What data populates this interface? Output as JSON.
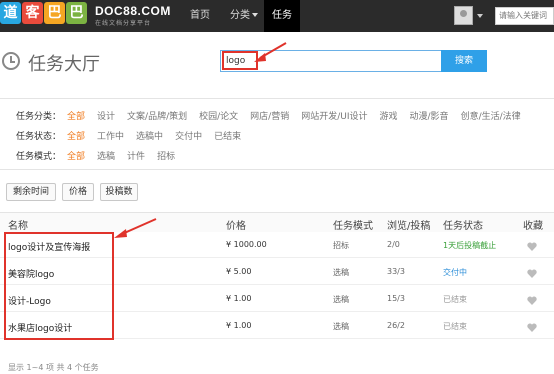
{
  "header": {
    "logo_chars": [
      "道",
      "客",
      "巴",
      "巴"
    ],
    "logo_text": "DOC88.COM",
    "logo_sub": "在线文档分享平台",
    "nav": {
      "home": "首页",
      "category": "分类",
      "task": "任务"
    },
    "search_placeholder": "请输入关键词"
  },
  "title": "任务大厅",
  "search": {
    "value": "logo",
    "button": "搜索"
  },
  "filters": {
    "category": {
      "label": "任务分类：",
      "options": [
        "全部",
        "设计",
        "文案/品牌/策划",
        "校园/论文",
        "网店/营销",
        "网站开发/UI设计",
        "游戏",
        "动漫/影音",
        "创意/生活/法律"
      ]
    },
    "status": {
      "label": "任务状态：",
      "options": [
        "全部",
        "工作中",
        "选稿中",
        "交付中",
        "已结束"
      ]
    },
    "mode": {
      "label": "任务模式：",
      "options": [
        "全部",
        "选稿",
        "计件",
        "招标"
      ]
    }
  },
  "sort": {
    "time": "剩余时间",
    "price": "价格",
    "bids": "投稿数"
  },
  "table": {
    "headers": {
      "name": "名称",
      "price": "价格",
      "mode": "任务模式",
      "views": "浏览/投稿",
      "status": "任务状态",
      "fav": "收藏"
    },
    "rows": [
      {
        "name": "logo设计及宣传海报",
        "price": "¥ 1000.00",
        "mode": "招标",
        "views": "2/0",
        "status": "1天后投稿截止"
      },
      {
        "name": "美容院logo",
        "price": "¥ 5.00",
        "mode": "选稿",
        "views": "33/3",
        "status": "交付中"
      },
      {
        "name": "设计-Logo",
        "price": "¥ 1.00",
        "mode": "选稿",
        "views": "15/3",
        "status": "已结束"
      },
      {
        "name": "水果店logo设计",
        "price": "¥ 1.00",
        "mode": "选稿",
        "views": "26/2",
        "status": "已结束"
      }
    ]
  },
  "footer": "显示 1~4 项 共 4 个任务",
  "colors": {
    "accent": "#f07b1e",
    "button_blue": "#2fa0e8",
    "annotation_red": "#e0332b"
  }
}
